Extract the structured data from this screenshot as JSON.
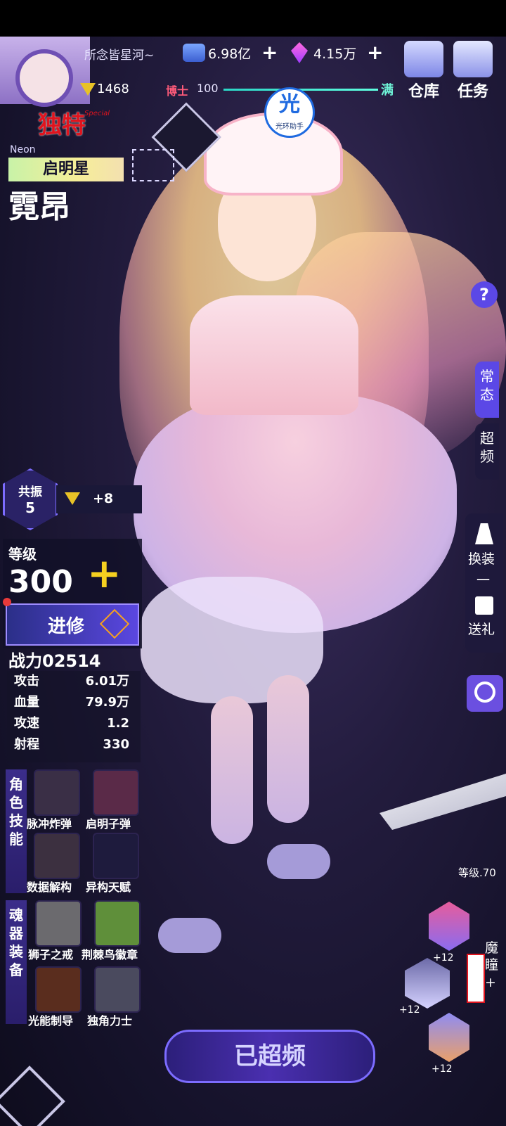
{
  "header": {
    "player_name": "所念皆星河~",
    "currency1": {
      "icon": "credits-icon",
      "value": "6.98亿",
      "plus": "+"
    },
    "currency2": {
      "icon": "crystal-icon",
      "value": "4.15万",
      "plus": "+"
    },
    "warehouse_label": "仓库",
    "quest_label": "任务",
    "rank_value": "1468",
    "title_label": "博士",
    "title_level": "100",
    "title_full": "满",
    "assistant_label": "光环助手",
    "assistant_glyph": "光"
  },
  "character": {
    "rarity": "独特",
    "rarity_sub": "Special",
    "en_name": "Neon",
    "series": "启明星",
    "name": "霓昂",
    "resonance_label": "共振",
    "resonance_value": "5",
    "bonus": "+8",
    "level_label": "等级",
    "level": "300",
    "level_plus": "+",
    "advance_button": "进修",
    "power_label": "战力",
    "power_value": "02514",
    "stats": [
      {
        "label": "攻击",
        "value": "6.01万"
      },
      {
        "label": "血量",
        "value": "79.9万"
      },
      {
        "label": "攻速",
        "value": "1.2"
      },
      {
        "label": "射程",
        "value": "330"
      }
    ]
  },
  "skills": {
    "section_label": "角色技能",
    "items": [
      {
        "label": "脉冲炸弹",
        "color": "#3a2f46"
      },
      {
        "label": "启明子弹",
        "color": "#5a2a48"
      },
      {
        "label": "数据解构",
        "color": "#3c3040"
      },
      {
        "label": "异构天赋",
        "color": "#1e1b3d"
      }
    ]
  },
  "equipment": {
    "section_label": "魂器装备",
    "items": [
      {
        "label": "狮子之戒",
        "color": "#6b6a6e"
      },
      {
        "label": "荆棘鸟徽章",
        "color": "#5f8f3a"
      },
      {
        "label": "光能制导",
        "color": "#5a2d1e"
      },
      {
        "label": "独角力士",
        "color": "#4a4a5e"
      }
    ]
  },
  "right_panel": {
    "help": "?",
    "mode_normal": "常态",
    "mode_overclock": "超频",
    "outfit_label": "换装",
    "outfit_dash": "一",
    "gift_label": "送礼",
    "weapon_level": "等级.70",
    "gear_plus_top": "+12",
    "gear_plus_mid": "+12",
    "gear_plus_bot": "+12",
    "eye_label": "魔瞳",
    "eye_plus": "+"
  },
  "bottom": {
    "overclocked_button": "已超频"
  },
  "colors": {
    "accent": "#6b4fe0",
    "gold": "#f5d020",
    "rarity_red": "#e0141e"
  }
}
